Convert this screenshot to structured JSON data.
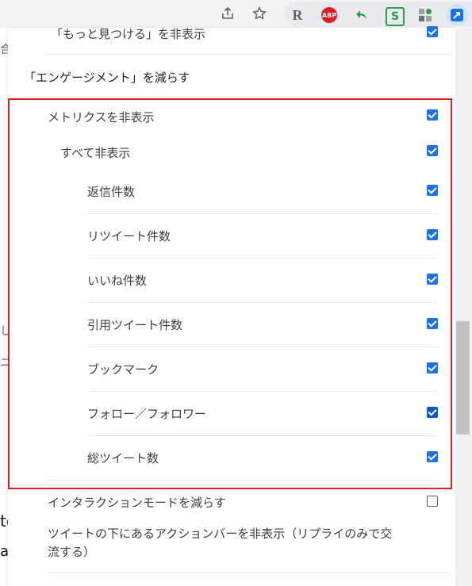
{
  "browser": {
    "share_icon": "share-icon",
    "star_icon": "star-icon",
    "extensions": [
      {
        "name": "r-extension",
        "label": "R"
      },
      {
        "name": "adblock-plus",
        "label": "ABP"
      },
      {
        "name": "green-arrow-extension",
        "label": ""
      },
      {
        "name": "s-extension",
        "label": "S"
      },
      {
        "name": "puzzle-extension",
        "label": ""
      },
      {
        "name": "active-extension",
        "label": ""
      }
    ]
  },
  "settings": {
    "hide_more_finds": "「もっと見つける」を非表示",
    "reduce_engagement": "「エンゲージメント」を減らす",
    "hide_metrics": "メトリクスを非表示",
    "hide_all": "すべて非表示",
    "reply_count": "返信件数",
    "retweet_count": "リツイート件数",
    "like_count": "いいね件数",
    "quote_count": "引用ツイート件数",
    "bookmark": "ブックマーク",
    "follow_follower": "フォロー／フォロワー",
    "total_tweets": "総ツイート数",
    "reduce_interaction": "インタラクションモードを減らす",
    "hide_action_bar_line1": "ツイートの下にあるアクションバーを非表示（リプライのみで交",
    "hide_action_bar_line2": "流する）"
  }
}
